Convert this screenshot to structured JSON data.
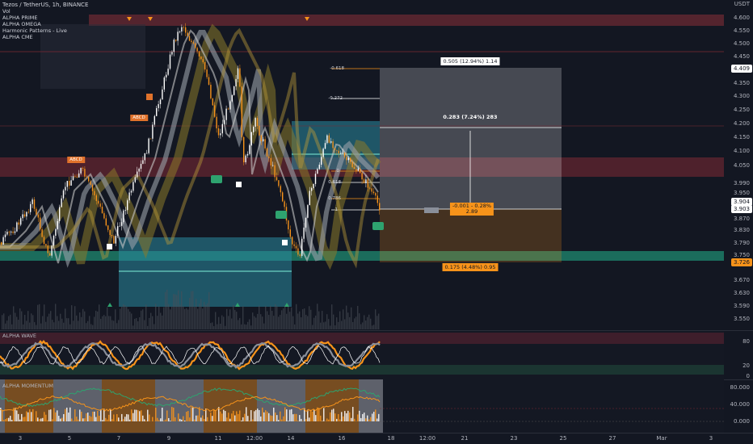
{
  "header": {
    "title": "Tezos / TetherUS, 1h, BINANCE",
    "indicators": [
      "Vol",
      "ALPHA PRIME",
      "ALPHA OMEGA",
      "Harmonic Patterns - Live",
      "ALPHA CME"
    ],
    "currency": "USDT"
  },
  "price_scale": [
    "4.600",
    "4.550",
    "4.500",
    "4.450",
    "4.350",
    "4.300",
    "4.250",
    "4.200",
    "4.150",
    "4.100",
    "4.050",
    "3.990",
    "3.950",
    "3.870",
    "3.830",
    "3.790",
    "3.750",
    "3.670",
    "3.630",
    "3.590",
    "3.550"
  ],
  "price_tags": {
    "top": "4.409",
    "current_a": "3.904",
    "current_b": "3.903",
    "low": "3.726"
  },
  "fib_labels": [
    "-0.618",
    "-0.272",
    "0",
    "0.618",
    "0.786",
    "1"
  ],
  "measure": {
    "top_label": "0.505 (12.94%) 1.14",
    "mid_label": "0.283 (7.24%) 283",
    "neg_label_line1": "-0.001 - 0.28%",
    "neg_label_line2": "2.89",
    "bottom_label": "0.175 (4.48%) 0.95"
  },
  "pattern_labels": {
    "abcd_1": "ABCD",
    "abcd_2": "ABCD",
    "ex": "Ex",
    "sx": "Sx",
    "lx": "Lx"
  },
  "wave_pane": {
    "title": "ALPHA WAVE",
    "scale": [
      "80",
      "20",
      "0"
    ]
  },
  "momentum_pane": {
    "title": "ALPHA MOMENTUM",
    "scale": [
      "80.000",
      "40.000",
      "0.000"
    ]
  },
  "time_axis": [
    "3",
    "5",
    "7",
    "9",
    "11",
    "12:00",
    "14",
    "16",
    "18",
    "12:00",
    "21",
    "23",
    "25",
    "27",
    "Mar",
    "3"
  ],
  "colors": {
    "background": "#131722",
    "bull": "#ffffff",
    "bear": "#f7931a",
    "teal": "#26a69a",
    "red_zone": "#7f2a35",
    "green_line": "#2ea36f"
  }
}
